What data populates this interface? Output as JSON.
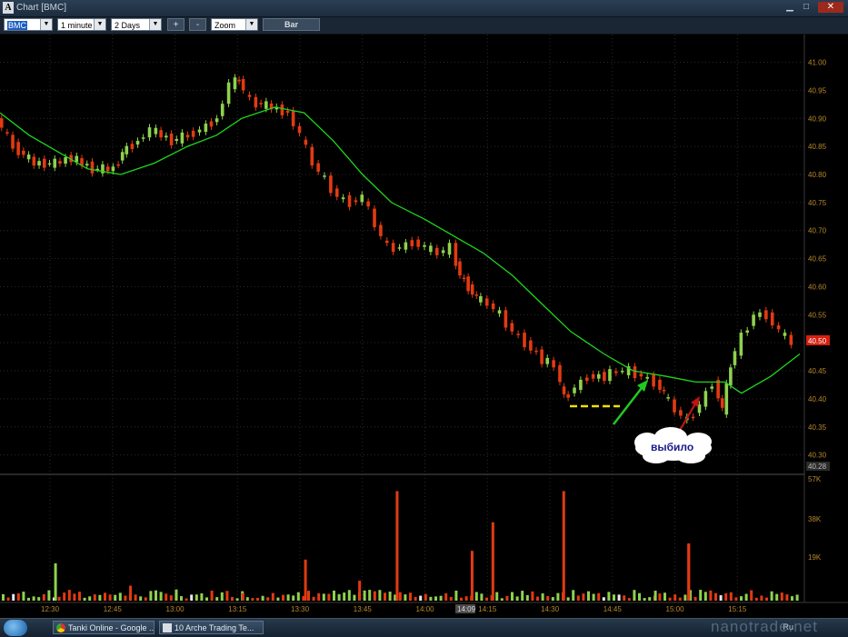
{
  "window": {
    "title": "Chart [BMC]",
    "icon": "A"
  },
  "toolbar": {
    "symbol": "BMC",
    "interval": "1 minute",
    "range": "2 Days",
    "zoom_in": "+",
    "zoom_out": "-",
    "zoom_mode": "Zoom",
    "chart_type": "Bar"
  },
  "annotation": {
    "bubble_text": "выбило"
  },
  "price_axis": {
    "ticks": [
      "41.00",
      "40.95",
      "40.90",
      "40.85",
      "40.80",
      "40.75",
      "40.70",
      "40.65",
      "40.60",
      "40.55",
      "40.50",
      "40.45",
      "40.40",
      "40.35",
      "40.30"
    ],
    "current_price_label": "40.50",
    "bottom_label": "40.28"
  },
  "volume_axis": {
    "ticks": [
      "57K",
      "38K",
      "19K"
    ]
  },
  "time_axis": {
    "ticks": [
      "12:30",
      "12:45",
      "13:00",
      "13:15",
      "13:30",
      "13:45",
      "14:00",
      "14:15",
      "14:30",
      "14:45",
      "15:00",
      "15:15"
    ],
    "cursor_label": "14:09"
  },
  "taskbar": {
    "tasks": [
      "Tanki Online - Google ...",
      "10 Arche Trading Te..."
    ],
    "tray_text": "Ru",
    "watermark": "nanotrade.net"
  },
  "colors": {
    "up": "#8fd14f",
    "down": "#e23a12",
    "ma": "#1ed61e",
    "axis_text": "#b8892e",
    "annotation_arrow_up": "#22c922",
    "annotation_arrow_down": "#c01414",
    "support_line": "#f2e000"
  },
  "chart_data": {
    "type": "candlestick",
    "title": "Chart [BMC]",
    "interval": "1 minute",
    "price_range": [
      40.28,
      41.03
    ],
    "x_range": [
      "12:18",
      "15:30"
    ],
    "moving_average_points": [
      [
        "12:18",
        40.91
      ],
      [
        "12:25",
        40.87
      ],
      [
        "12:32",
        40.84
      ],
      [
        "12:39",
        40.81
      ],
      [
        "12:47",
        40.8
      ],
      [
        "12:55",
        40.82
      ],
      [
        "13:03",
        40.85
      ],
      [
        "13:10",
        40.87
      ],
      [
        "13:16",
        40.9
      ],
      [
        "13:24",
        40.92
      ],
      [
        "13:31",
        40.91
      ],
      [
        "13:38",
        40.86
      ],
      [
        "13:45",
        40.8
      ],
      [
        "13:52",
        40.75
      ],
      [
        "14:00",
        40.72
      ],
      [
        "14:07",
        40.69
      ],
      [
        "14:14",
        40.66
      ],
      [
        "14:21",
        40.62
      ],
      [
        "14:28",
        40.57
      ],
      [
        "14:35",
        40.52
      ],
      [
        "14:43",
        40.48
      ],
      [
        "14:50",
        40.45
      ],
      [
        "14:58",
        40.44
      ],
      [
        "15:05",
        40.43
      ],
      [
        "15:12",
        40.43
      ],
      [
        "15:16",
        40.41
      ],
      [
        "15:23",
        40.44
      ],
      [
        "15:30",
        40.48
      ]
    ],
    "close_points": [
      [
        "12:18",
        40.9
      ],
      [
        "12:22",
        40.85
      ],
      [
        "12:27",
        40.82
      ],
      [
        "12:32",
        40.82
      ],
      [
        "12:36",
        40.83
      ],
      [
        "12:41",
        40.81
      ],
      [
        "12:46",
        40.81
      ],
      [
        "12:48",
        40.84
      ],
      [
        "12:52",
        40.86
      ],
      [
        "12:55",
        40.88
      ],
      [
        "13:00",
        40.86
      ],
      [
        "13:04",
        40.87
      ],
      [
        "13:07",
        40.88
      ],
      [
        "13:11",
        40.9
      ],
      [
        "13:14",
        40.96
      ],
      [
        "13:16",
        40.97
      ],
      [
        "13:19",
        40.93
      ],
      [
        "13:24",
        40.92
      ],
      [
        "13:28",
        40.91
      ],
      [
        "13:31",
        40.87
      ],
      [
        "13:34",
        40.82
      ],
      [
        "13:37",
        40.79
      ],
      [
        "13:40",
        40.76
      ],
      [
        "13:43",
        40.75
      ],
      [
        "13:46",
        40.76
      ],
      [
        "13:49",
        40.71
      ],
      [
        "13:52",
        40.67
      ],
      [
        "13:55",
        40.67
      ],
      [
        "13:58",
        40.68
      ],
      [
        "14:01",
        40.67
      ],
      [
        "14:04",
        40.66
      ],
      [
        "14:07",
        40.67
      ],
      [
        "14:09",
        40.62
      ],
      [
        "14:11",
        40.6
      ],
      [
        "14:13",
        40.58
      ],
      [
        "14:16",
        40.57
      ],
      [
        "14:19",
        40.55
      ],
      [
        "14:22",
        40.52
      ],
      [
        "14:25",
        40.5
      ],
      [
        "14:29",
        40.47
      ],
      [
        "14:32",
        40.46
      ],
      [
        "14:34",
        40.4
      ],
      [
        "14:37",
        40.42
      ],
      [
        "14:40",
        40.44
      ],
      [
        "14:44",
        40.44
      ],
      [
        "14:47",
        40.45
      ],
      [
        "14:50",
        40.45
      ],
      [
        "14:53",
        40.44
      ],
      [
        "14:56",
        40.43
      ],
      [
        "14:58",
        40.41
      ],
      [
        "15:01",
        40.38
      ],
      [
        "15:04",
        40.36
      ],
      [
        "15:07",
        40.39
      ],
      [
        "15:10",
        40.43
      ],
      [
        "15:12",
        40.38
      ],
      [
        "15:14",
        40.46
      ],
      [
        "15:17",
        40.51
      ],
      [
        "15:20",
        40.55
      ],
      [
        "15:23",
        40.55
      ],
      [
        "15:26",
        40.52
      ],
      [
        "15:29",
        40.5
      ]
    ],
    "support_level": 40.39,
    "volume_bars": [
      [
        "12:31",
        30
      ],
      [
        "12:49",
        12
      ],
      [
        "13:00",
        9
      ],
      [
        "13:16",
        6
      ],
      [
        "13:31",
        33
      ],
      [
        "13:44",
        16
      ],
      [
        "13:53",
        88
      ],
      [
        "14:11",
        40
      ],
      [
        "14:16",
        63
      ],
      [
        "14:33",
        88
      ],
      [
        "14:55",
        8
      ],
      [
        "15:03",
        46
      ],
      [
        "15:03",
        45
      ]
    ],
    "volume_unit": "K"
  }
}
